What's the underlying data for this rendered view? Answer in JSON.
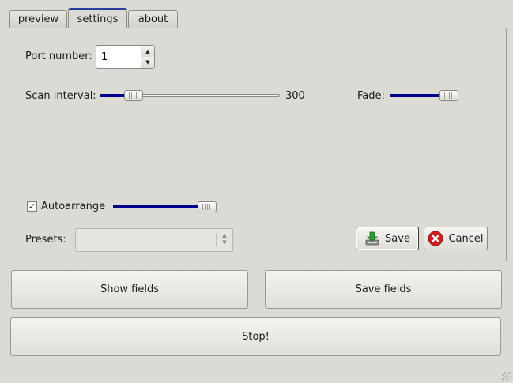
{
  "tabs": [
    {
      "label": "preview",
      "active": false
    },
    {
      "label": "settings",
      "active": true
    },
    {
      "label": "about",
      "active": false
    }
  ],
  "settings": {
    "port": {
      "label": "Port number:",
      "value": "1"
    },
    "scan_interval": {
      "label": "Scan interval:",
      "value": "300",
      "level": 0.15
    },
    "fade": {
      "label": "Fade:",
      "level": 1.0
    },
    "autoarrange": {
      "label": "Autoarrange",
      "checked": true,
      "check_mark": "✓",
      "level": 1.0
    },
    "presets": {
      "label": "Presets:",
      "value": ""
    },
    "save_label": "Save",
    "cancel_label": "Cancel"
  },
  "buttons": {
    "show_fields": "Show fields",
    "save_fields": "Save fields",
    "stop": "Stop!"
  },
  "icons": {
    "save": "save-download-icon",
    "cancel": "cancel-icon",
    "spin_up": "▲",
    "spin_down": "▼",
    "combo_arrows": "▲▼"
  },
  "colors": {
    "slider_fill": "#00008b",
    "active_tab_accent": "#2a3f9a",
    "background": "#dcdad5",
    "save_icon_green": "#2e9e2e",
    "cancel_icon_red": "#d11f1f"
  }
}
